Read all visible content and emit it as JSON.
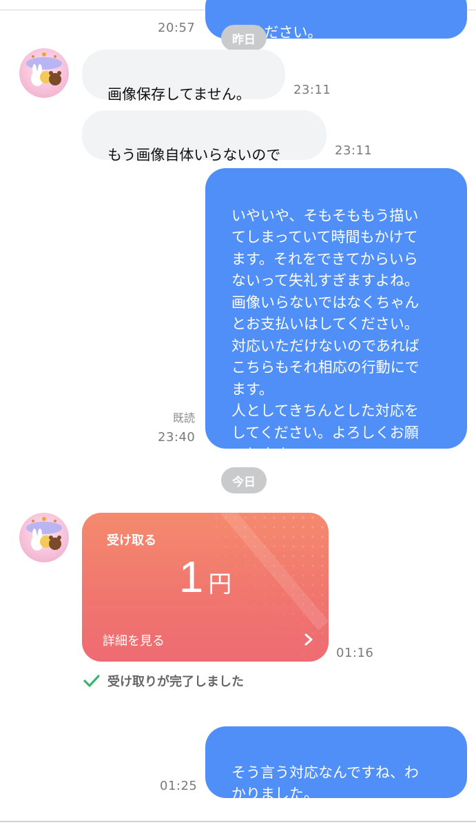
{
  "messages": {
    "top_partial_out": {
      "text": "てください。",
      "time": "20:57"
    },
    "date_yesterday": "昨日",
    "in_1": {
      "text": "画像保存してません。",
      "time": "23:11"
    },
    "in_2": {
      "text": "もう画像自体いらないので",
      "time": "23:11"
    },
    "out_long": {
      "text": "いやいや、そもそももう描い\nてしまっていて時間もかけて\nます。それをできてからいら\nないって失礼すぎますよね。\n画像いらないではなくちゃん\nとお支払いはしてください。\n対応いただけないのであれば\nこちらもそれ相応の行動にで\nます。\n人としてきちんとした対応を\nしてください。よろしくお願\nいします",
      "read": "既読",
      "time": "23:40"
    },
    "date_today": "今日",
    "payment": {
      "label": "受け取る",
      "amount": "1",
      "unit": "円",
      "detail_link": "詳細を見る",
      "time": "01:16",
      "status": "受け取りが完了しました"
    },
    "out_last": {
      "text": "そう言う対応なんですね、わ\nかりました。",
      "time": "01:25"
    }
  },
  "icons": {
    "avatar": "avatar-image",
    "chevron": "chevron-right-icon",
    "check": "check-icon"
  },
  "colors": {
    "sent_bubble": "#4f8ff7",
    "received_bubble": "#f2f3f5",
    "date_pill": "#c9cacc",
    "payment_card": "#f0766e",
    "check": "#3cb371"
  }
}
